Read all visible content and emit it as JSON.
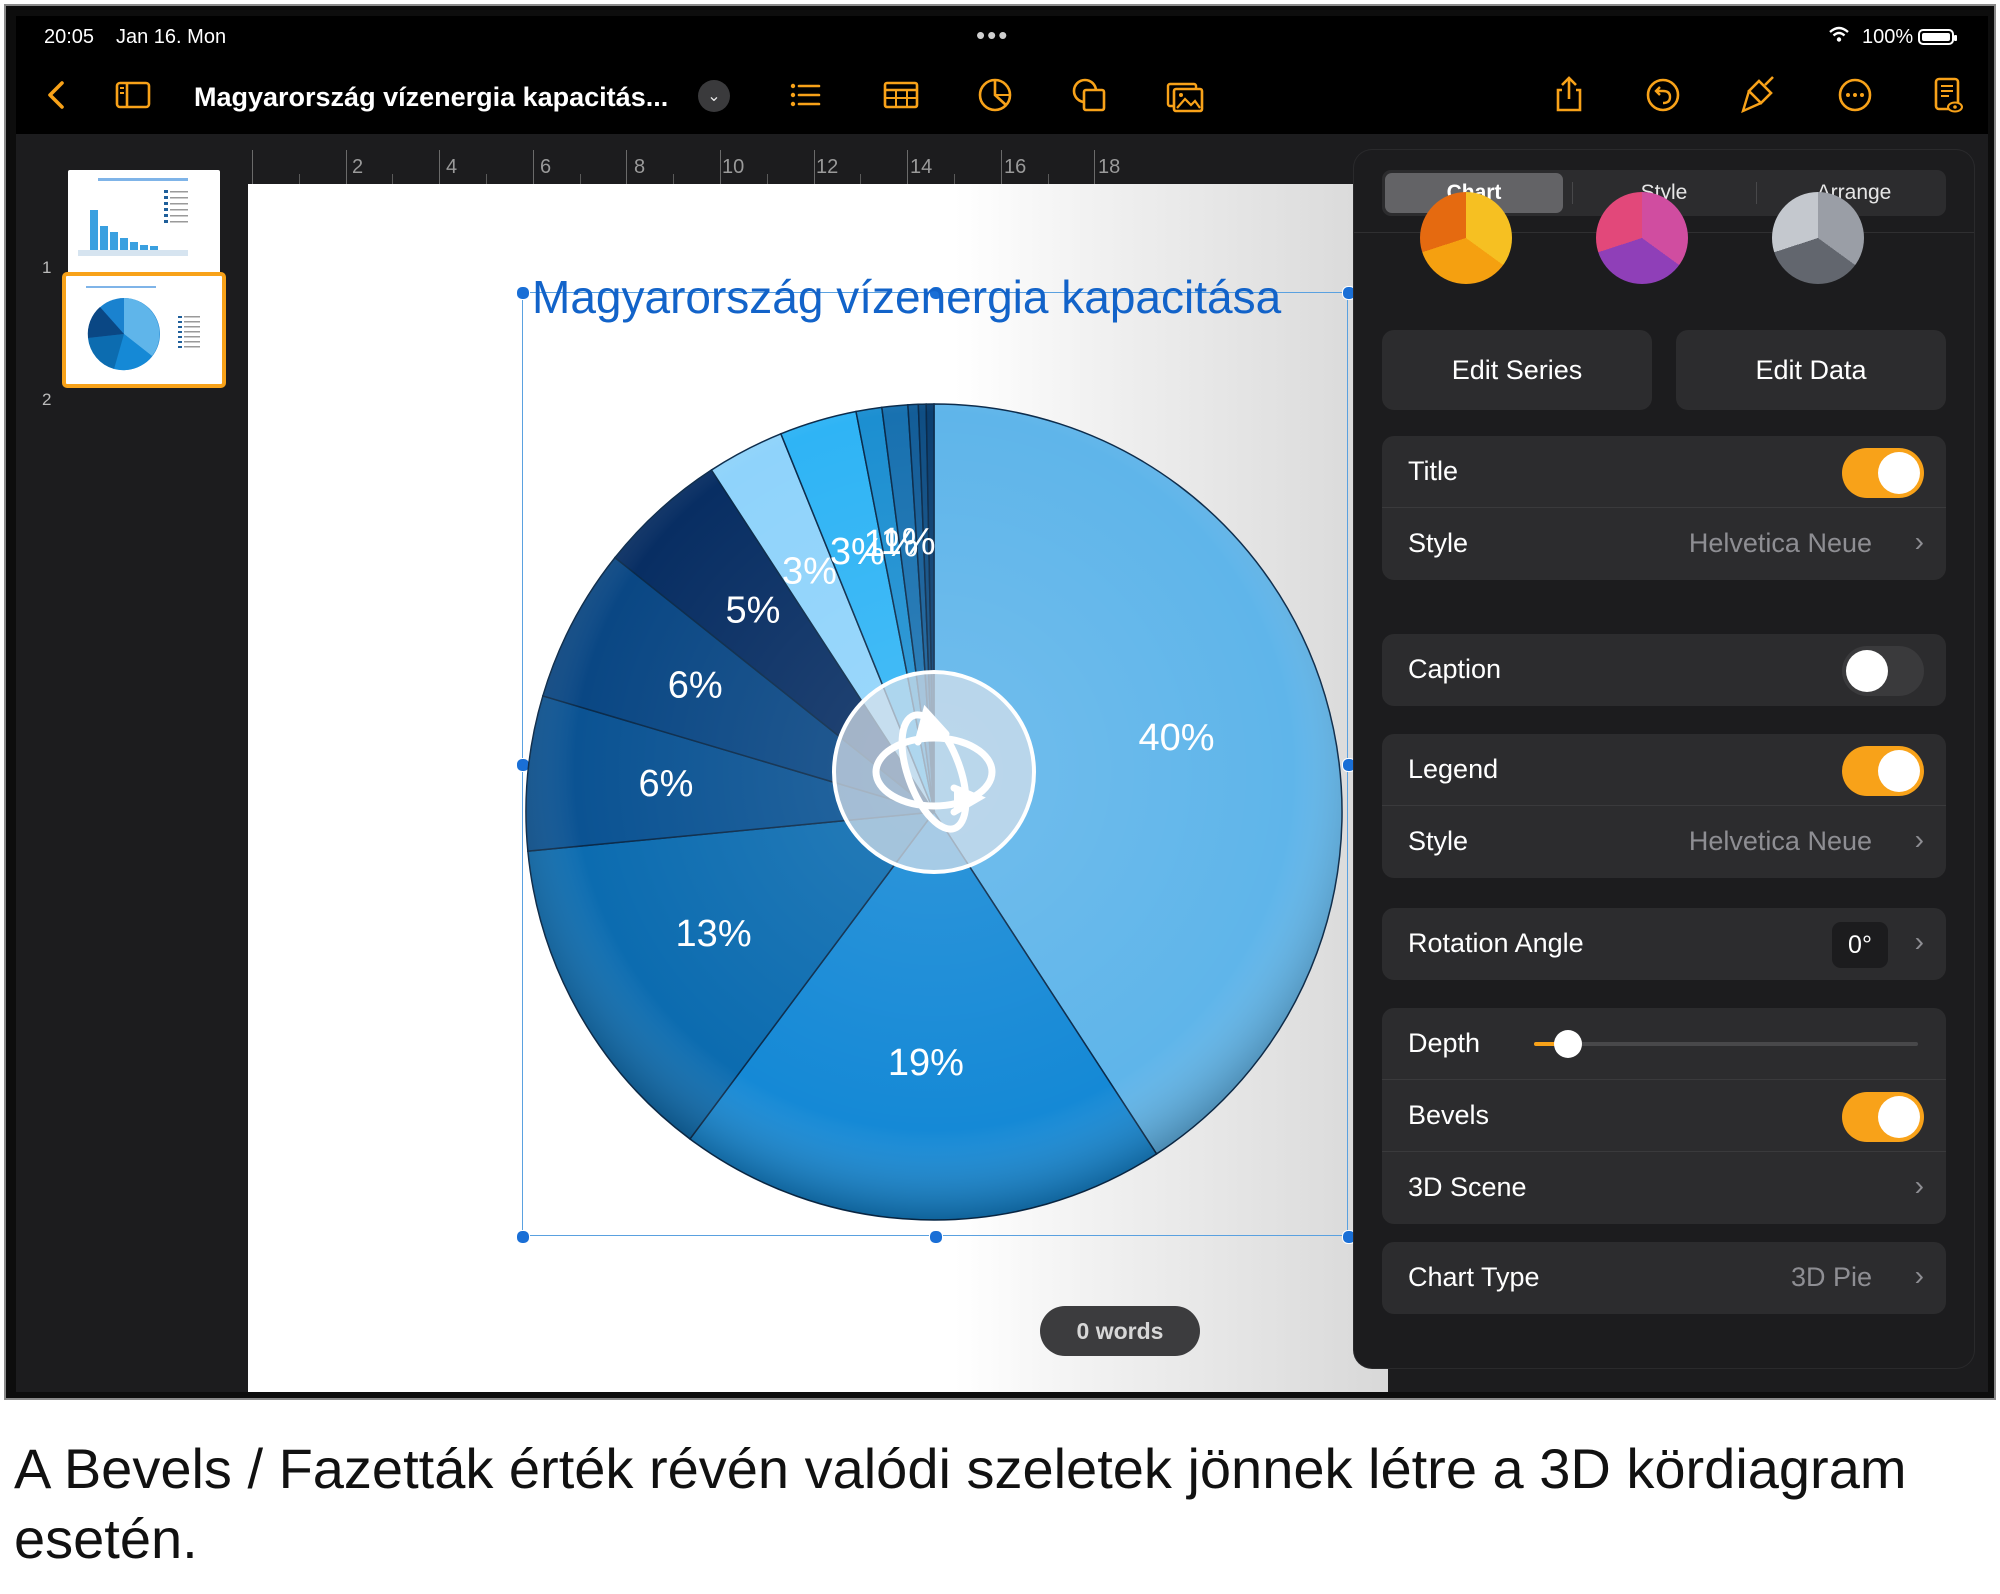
{
  "status_bar": {
    "time": "20:05",
    "date": "Jan 16. Mon",
    "battery": "100%"
  },
  "toolbar": {
    "doc_title": "Magyarország vízenergia kapacitás...",
    "accent": "#f8a219"
  },
  "sidebar": {
    "slides": [
      {
        "number": "1"
      },
      {
        "number": "2",
        "selected": true
      }
    ]
  },
  "ruler": {
    "numbers": [
      "2",
      "4",
      "6",
      "8",
      "10",
      "12",
      "14",
      "16",
      "18"
    ]
  },
  "slide": {
    "chart_title": "Magyarország vízenergia kapacitása",
    "word_count": "0 words"
  },
  "chart_data": {
    "type": "pie",
    "title": "Magyarország vízenergia kapacitása",
    "slices": [
      {
        "label": "40%",
        "value": 40,
        "color": "#5fb5ea"
      },
      {
        "label": "19%",
        "value": 19,
        "color": "#1589d6"
      },
      {
        "label": "13%",
        "value": 13,
        "color": "#0c6cb0"
      },
      {
        "label": "6%",
        "value": 6,
        "color": "#0b5393"
      },
      {
        "label": "6%",
        "value": 6,
        "color": "#0a4784"
      },
      {
        "label": "5%",
        "value": 5,
        "color": "#082e63"
      },
      {
        "label": "3%",
        "value": 3,
        "color": "#8fd3fb"
      },
      {
        "label": "3%",
        "value": 3,
        "color": "#2fb4f5"
      },
      {
        "label": "1%",
        "value": 1,
        "color": "#1c8fd1"
      },
      {
        "label": "1%",
        "value": 1,
        "color": "#1871b0"
      },
      {
        "label": "",
        "value": 0.4,
        "color": "#135d98"
      },
      {
        "label": "",
        "value": 0.3,
        "color": "#0f4e84"
      },
      {
        "label": "",
        "value": 0.3,
        "color": "#0b3f70"
      }
    ],
    "start_angle_deg": 0,
    "labels_inside": true
  },
  "popover": {
    "tabs": [
      {
        "label": "Chart",
        "active": true
      },
      {
        "label": "Style"
      },
      {
        "label": "Arrange"
      }
    ],
    "edit_series": "Edit Series",
    "edit_data": "Edit Data",
    "title_row": {
      "label": "Title",
      "on": true
    },
    "title_style": {
      "label": "Style",
      "value": "Helvetica Neue"
    },
    "caption_row": {
      "label": "Caption",
      "on": false
    },
    "legend_row": {
      "label": "Legend",
      "on": true
    },
    "legend_style": {
      "label": "Style",
      "value": "Helvetica Neue"
    },
    "rotation": {
      "label": "Rotation Angle",
      "value": "0°"
    },
    "depth": {
      "label": "Depth",
      "value": 0.08
    },
    "bevels": {
      "label": "Bevels",
      "on": true
    },
    "scene": {
      "label": "3D Scene"
    },
    "chart_type": {
      "label": "Chart Type",
      "value": "3D Pie"
    }
  },
  "caption": "A Bevels / Fazetták érték révén valódi szeletek jönnek létre a 3D kördiagram esetén."
}
